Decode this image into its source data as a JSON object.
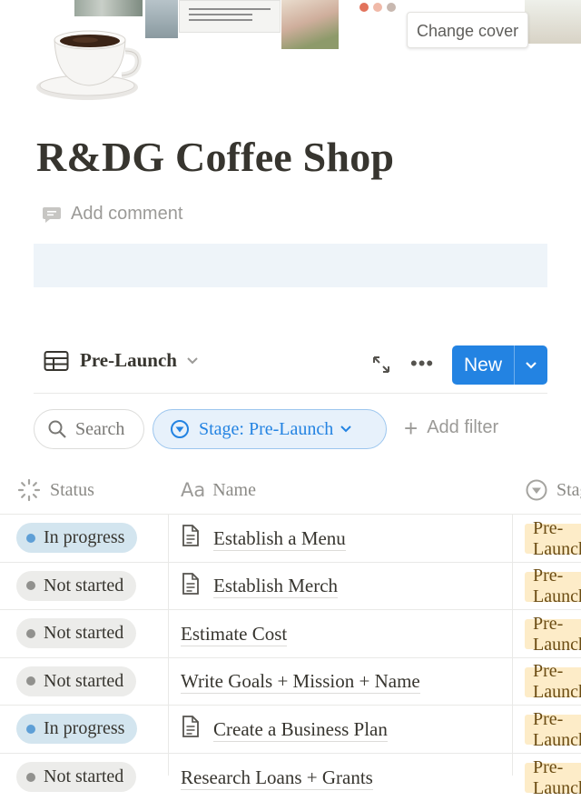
{
  "cover": {
    "change_cover_label": "Change cover",
    "note_tile_text": "10 And do not forget to do good and to share with others, for with such sacrifices God is pleased. —Hebrews 13:16"
  },
  "page": {
    "icon": "coffee-cup-icon",
    "title": "R&DG Coffee Shop",
    "add_comment_label": "Add comment"
  },
  "view": {
    "name": "Pre-Launch",
    "new_label": "New",
    "more_label": "•••"
  },
  "filters": {
    "search_label": "Search",
    "active_filter_label": "Stage: Pre-Launch",
    "add_filter_label": "Add filter"
  },
  "table": {
    "columns": {
      "status": "Status",
      "name_prefix": "Aa",
      "name": "Name",
      "stage": "Stage"
    },
    "rows": [
      {
        "status": "In progress",
        "name": "Establish a Menu",
        "has_doc_icon": true,
        "stage": "Pre-Launch"
      },
      {
        "status": "Not started",
        "name": "Establish Merch",
        "has_doc_icon": true,
        "stage": "Pre-Launch"
      },
      {
        "status": "Not started",
        "name": "Estimate Cost",
        "has_doc_icon": false,
        "stage": "Pre-Launch"
      },
      {
        "status": "Not started",
        "name": "Write Goals + Mission + Name",
        "has_doc_icon": false,
        "stage": "Pre-Launch"
      },
      {
        "status": "In progress",
        "name": "Create a Business Plan",
        "has_doc_icon": true,
        "stage": "Pre-Launch"
      },
      {
        "status": "Not started",
        "name": "Research Loans + Grants",
        "has_doc_icon": false,
        "stage": "Pre-Launch"
      }
    ]
  },
  "colors": {
    "accent": "#2383e2",
    "in_progress_bg": "#d3e5ef",
    "in_progress_dot": "#5e9fd6",
    "not_started_bg": "#ececea",
    "not_started_dot": "#91918e",
    "stage_tag_bg": "#fdecc8",
    "callout_bg": "#eef4f9"
  }
}
